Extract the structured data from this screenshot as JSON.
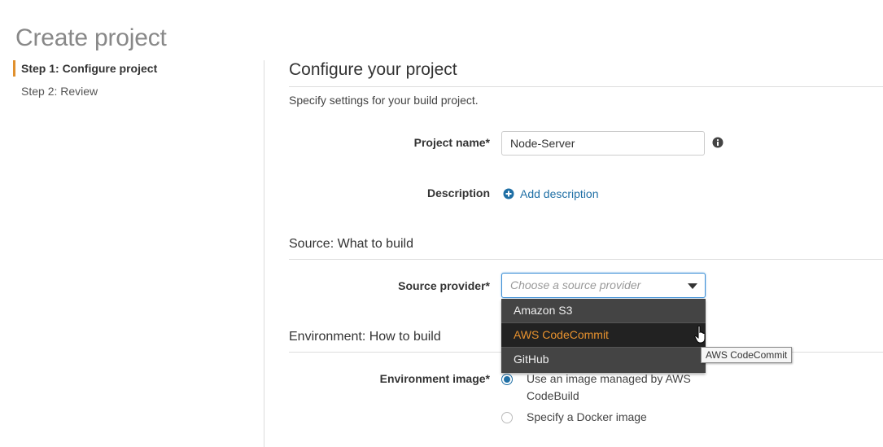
{
  "page": {
    "title": "Create project"
  },
  "steps": [
    {
      "label": "Step 1: Configure project",
      "active": true
    },
    {
      "label": "Step 2: Review",
      "active": false
    }
  ],
  "configure": {
    "heading": "Configure your project",
    "subtext": "Specify settings for your build project.",
    "project_name": {
      "label": "Project name*",
      "value": "Node-Server"
    },
    "description": {
      "label": "Description",
      "link": "Add description"
    }
  },
  "source": {
    "heading": "Source: What to build",
    "provider_label": "Source provider*",
    "placeholder": "Choose a source provider",
    "options": [
      "Amazon S3",
      "AWS CodeCommit",
      "GitHub"
    ],
    "highlighted": "AWS CodeCommit",
    "tooltip": "AWS CodeCommit"
  },
  "environment": {
    "heading": "Environment: How to build",
    "image_label": "Environment image*",
    "options": [
      {
        "label": "Use an image managed by AWS CodeBuild",
        "selected": true
      },
      {
        "label": "Specify a Docker image",
        "selected": false
      }
    ]
  },
  "colors": {
    "accent": "#e0902e",
    "link": "#1f6fa5",
    "dropdown_bg": "#444444",
    "highlight_text": "#e8922e"
  },
  "icons": [
    "info-icon",
    "plus-circle-icon",
    "chevron-down-icon",
    "hand-pointer-icon"
  ]
}
